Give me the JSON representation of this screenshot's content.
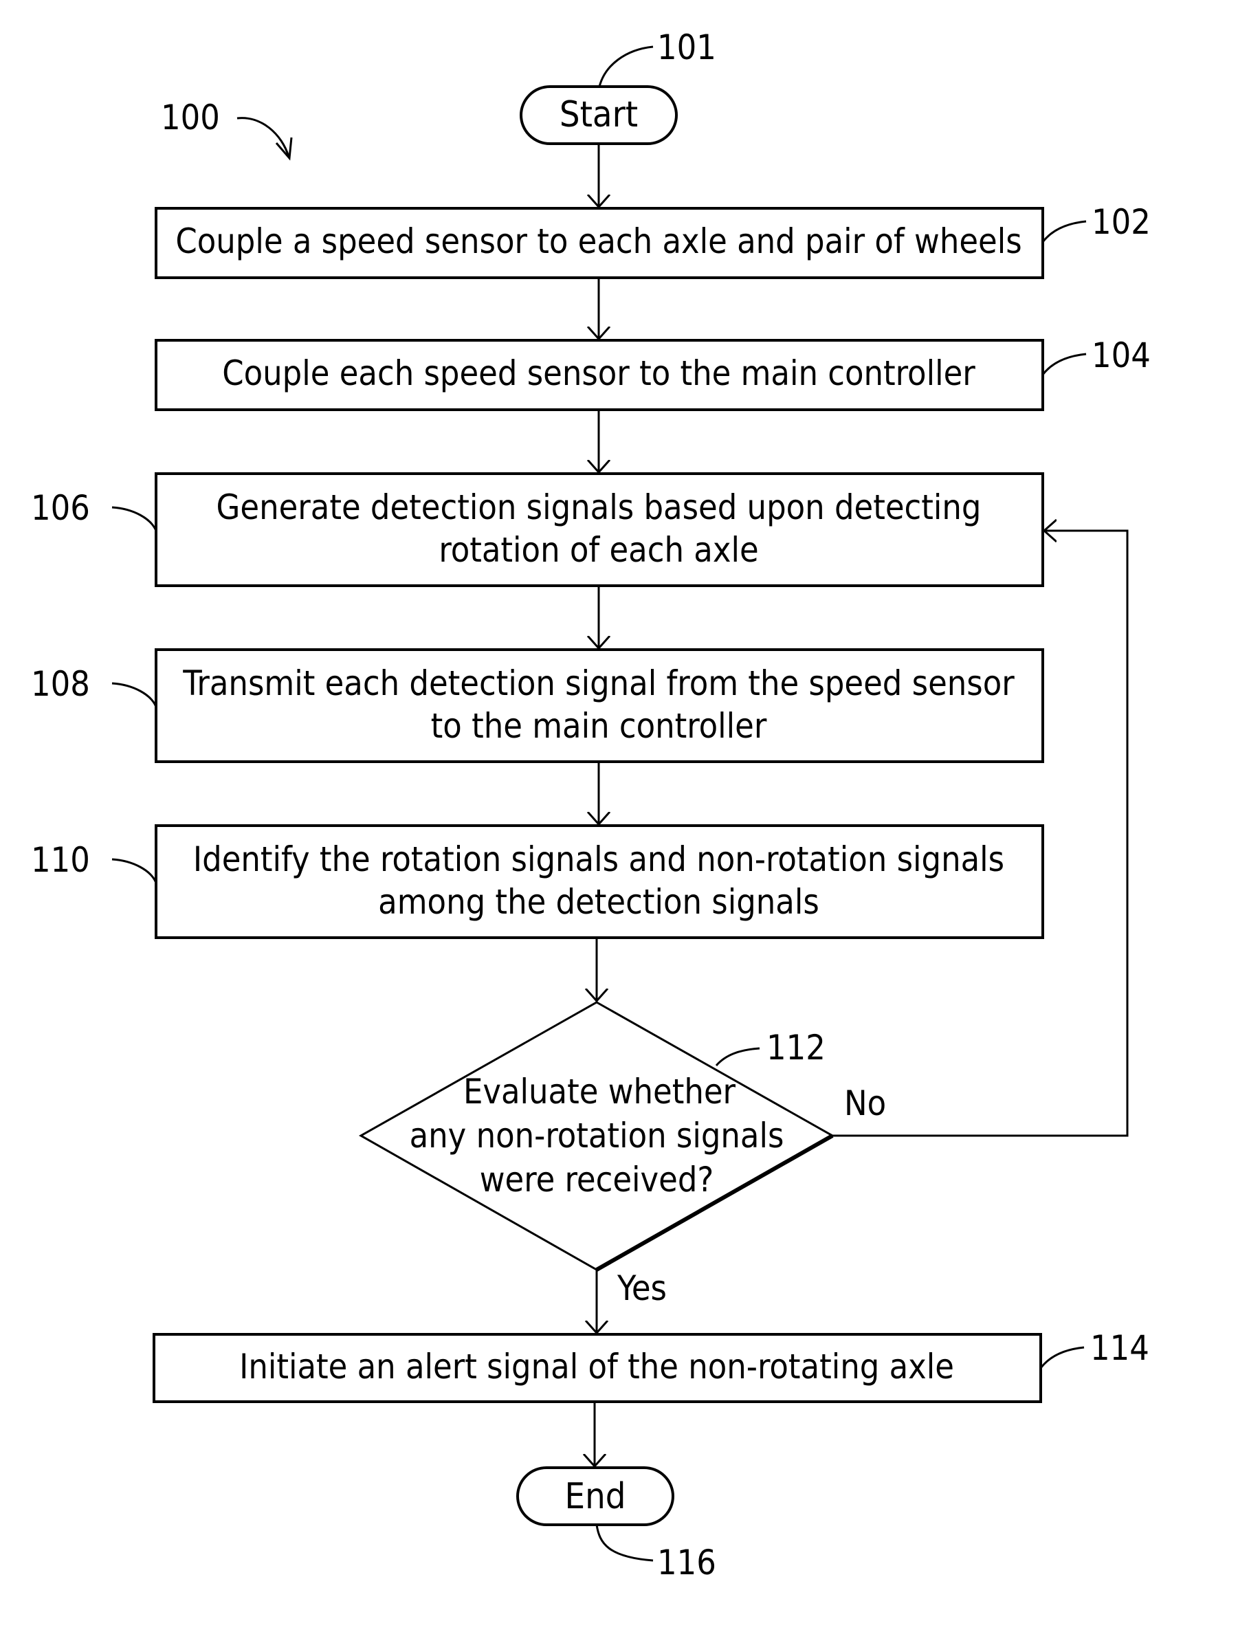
{
  "figure_number": "100",
  "nodes": {
    "start": {
      "ref": "101",
      "label": "Start"
    },
    "step102": {
      "ref": "102",
      "lines": [
        "Couple a speed sensor to each axle and pair of wheels"
      ]
    },
    "step104": {
      "ref": "104",
      "lines": [
        "Couple each speed sensor to the main controller"
      ]
    },
    "step106": {
      "ref": "106",
      "lines": [
        "Generate detection signals based upon detecting",
        "rotation of each axle"
      ]
    },
    "step108": {
      "ref": "108",
      "lines": [
        "Transmit each detection signal from the speed sensor",
        "to the main controller"
      ]
    },
    "step110": {
      "ref": "110",
      "lines": [
        "Identify the rotation signals and non-rotation signals",
        "among the detection signals"
      ]
    },
    "decision112": {
      "ref": "112",
      "lines": [
        "Evaluate whether",
        "any non-rotation signals",
        "were received?"
      ],
      "no_label": "No",
      "yes_label": "Yes"
    },
    "step114": {
      "ref": "114",
      "lines": [
        "Initiate an alert signal of the non-rotating axle"
      ]
    },
    "end": {
      "ref": "116",
      "label": "End"
    }
  }
}
